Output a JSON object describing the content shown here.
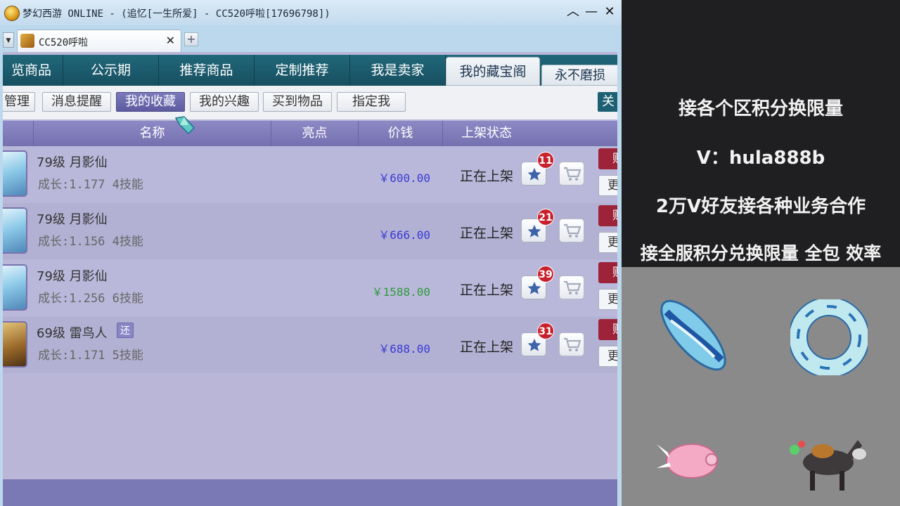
{
  "window": {
    "title": "梦幻西游 ONLINE - (追忆[一生所爱] - CC520呼啦[17696798])",
    "minimize": "︿",
    "maximize": "—",
    "close": "✕",
    "icon": "game-logo-icon"
  },
  "browser_tab": {
    "label": "CC520呼啦",
    "close": "✕",
    "new_tab": "+"
  },
  "main_nav": {
    "tabs": [
      {
        "label": "览商品"
      },
      {
        "label": "公示期"
      },
      {
        "label": "推荐商品"
      },
      {
        "label": "定制推荐"
      },
      {
        "label": "我是卖家"
      },
      {
        "label": "我的藏宝阁"
      }
    ],
    "active": "我的藏宝阁",
    "extra_button": "永不磨损"
  },
  "sub_nav": {
    "tabs": [
      {
        "label": "管理"
      },
      {
        "label": "消息提醒"
      },
      {
        "label": "我的收藏"
      },
      {
        "label": "我的兴趣"
      },
      {
        "label": "买到物品"
      },
      {
        "label": "指定我"
      }
    ],
    "active": "我的收藏",
    "right_button": "关"
  },
  "table": {
    "columns": [
      "名称",
      "亮点",
      "价钱",
      "上架状态"
    ],
    "rows": [
      {
        "name": "79级 月影仙",
        "growth": "成长:1.177 4技能",
        "price": "￥600.00",
        "price_color": "#3a3ad6",
        "status": "正在上架",
        "favorites": "11",
        "badge": "",
        "buy": "购",
        "more": "更"
      },
      {
        "name": "79级 月影仙",
        "growth": "成长:1.156 4技能",
        "price": "￥666.00",
        "price_color": "#3a3ad6",
        "status": "正在上架",
        "favorites": "21",
        "badge": "",
        "buy": "购",
        "more": "更"
      },
      {
        "name": "79级 月影仙",
        "growth": "成长:1.256 6技能",
        "price": "￥1588.00",
        "price_color": "#2e9a3c",
        "status": "正在上架",
        "favorites": "39",
        "badge": "",
        "buy": "购",
        "more": "更"
      },
      {
        "name": "69级 雷鸟人",
        "growth": "成长:1.171 5技能",
        "price": "￥688.00",
        "price_color": "#3a3ad6",
        "status": "正在上架",
        "favorites": "31",
        "badge": "还",
        "buy": "购",
        "more": "更"
      }
    ]
  },
  "overlay": {
    "line1": "接各个区积分换限量",
    "line2": "V：hula888b",
    "line3": "2万V好友接各种业务合作",
    "line4": "接全服积分兑换限量 全包 效率"
  },
  "gallery": {
    "items": [
      {
        "name": "surfboard"
      },
      {
        "name": "swim-ring"
      },
      {
        "name": "flying-pig"
      },
      {
        "name": "donkey-mount"
      }
    ]
  },
  "colors": {
    "nav_bg": "#1b5a6c",
    "table_header": "#7f7bbb",
    "row_bg": "#b8b6d8",
    "favorite_badge": "#c8202c",
    "buy_button": "#9c2338"
  }
}
